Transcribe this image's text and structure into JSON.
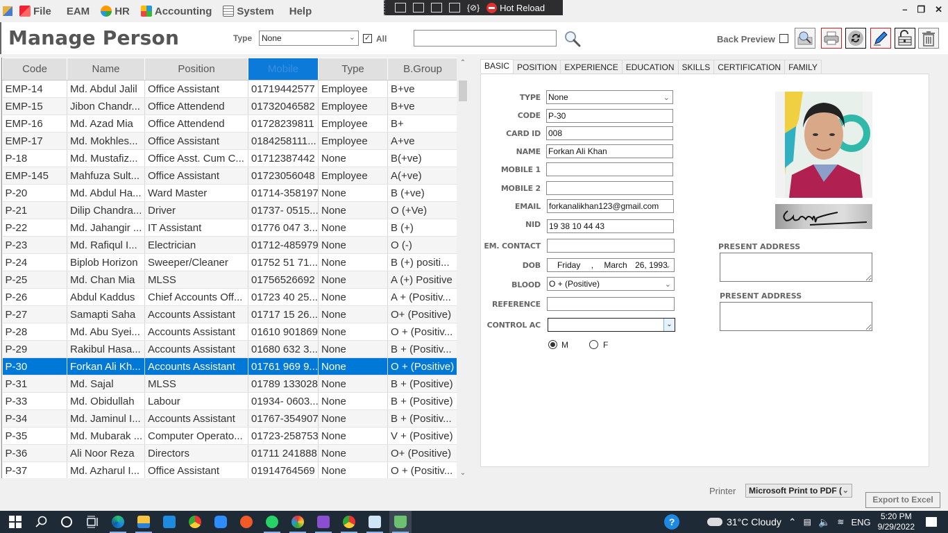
{
  "menubar": {
    "items": [
      {
        "label": "File",
        "icon": "file-icon"
      },
      {
        "label": "EAM",
        "icon": ""
      },
      {
        "label": "HR",
        "icon": "hr-icon"
      },
      {
        "label": "Accounting",
        "icon": "accounting-icon"
      },
      {
        "label": "System",
        "icon": "system-icon"
      },
      {
        "label": "Help",
        "icon": ""
      }
    ]
  },
  "devtools": {
    "hot_reload_label": "Hot Reload"
  },
  "window_controls": {
    "minimize": "–",
    "restore": "❐",
    "close": "✕"
  },
  "header": {
    "title": "Manage Person",
    "type_label": "Type",
    "type_value": "None",
    "all_label": "All",
    "all_checked": true,
    "search_value": "",
    "back_preview_label": "Back Preview",
    "back_preview_checked": false
  },
  "grid": {
    "columns": [
      "Code",
      "Name",
      "Position",
      "Mobile",
      "Type",
      "B.Group"
    ],
    "sorted_column": "Mobile",
    "selected_code": "P-30",
    "rows": [
      [
        "EMP-14",
        "Md. Abdul Jalil",
        "Office Assistant",
        "01719442577",
        "Employee",
        "B+ve"
      ],
      [
        "EMP-15",
        "Jibon Chandr...",
        "Office Attendend",
        "01732046582",
        "Employee",
        "B+ve"
      ],
      [
        "EMP-16",
        "Md. Azad Mia",
        "Office Attendend",
        "01728239811",
        "Employee",
        "B+"
      ],
      [
        "EMP-17",
        "Md. Mokhles...",
        "Office Assistant",
        "0184258111...",
        "Employee",
        "A+ve"
      ],
      [
        "P-18",
        "Md. Mustafiz...",
        "Office Asst. Cum C...",
        "01712387442",
        "None",
        "B(+ve)"
      ],
      [
        "EMP-145",
        "Mahfuza Sult...",
        "Office Assistant",
        "01723056048",
        "Employee",
        "A(+ve)"
      ],
      [
        "P-20",
        "Md. Abdul Ha...",
        "Ward Master",
        "01714-358197",
        "None",
        "B (+ve)"
      ],
      [
        "P-21",
        "Dilip Chandra...",
        "Driver",
        "01737- 0515...",
        "None",
        "O (+Ve)"
      ],
      [
        "P-22",
        "Md. Jahangir ...",
        "IT Assistant",
        "01776 047 3...",
        "None",
        "B (+)"
      ],
      [
        "P-23",
        "Md. Rafiqul I...",
        "Electrician",
        "01712-485979",
        "None",
        "O (-)"
      ],
      [
        "P-24",
        "Biplob Horizon",
        "Sweeper/Cleaner",
        "01752 51 71...",
        "None",
        "B (+) positi..."
      ],
      [
        "P-25",
        "Md. Chan Mia",
        "MLSS",
        "01756526692",
        "None",
        "A (+) Positive"
      ],
      [
        "P-26",
        "Abdul Kaddus",
        "Chief Accounts Off...",
        "01723 40 25...",
        "None",
        "A + (Positiv..."
      ],
      [
        "P-27",
        "Samapti Saha",
        "Accounts Assistant",
        "01717 15 26...",
        "None",
        "O+ (Positive)"
      ],
      [
        "P-28",
        "Md. Abu Syei...",
        "Accounts Assistant",
        "01610 901869",
        "None",
        "O + (Positiv..."
      ],
      [
        "P-29",
        "Rakibul Hasa...",
        "Accounts Assistant",
        "01680 632 3...",
        "None",
        "B + (Positiv..."
      ],
      [
        "P-30",
        "Forkan Ali Kh...",
        "Accounts Assistant",
        "01761 969 9...",
        "None",
        "O + (Positive)"
      ],
      [
        "P-31",
        "Md. Sajal",
        "MLSS",
        "01789 133028",
        "None",
        "B + (Positive)"
      ],
      [
        "P-33",
        "Md. Obidullah",
        "Labour",
        "01934- 0603...",
        "None",
        "B + (Positive)"
      ],
      [
        "P-34",
        "Md. Jaminul I...",
        "Accounts Assistant",
        "01767-354907",
        "None",
        "B + (Positiv..."
      ],
      [
        "P-35",
        "Md. Mubarak ...",
        "Computer Operato...",
        "01723-258753",
        "None",
        "V + (Positive)"
      ],
      [
        "P-36",
        "Ali Noor Reza",
        "Directors",
        "01711 241888",
        "None",
        "O+ (Positive)"
      ],
      [
        "P-37",
        "Md. Azharul I...",
        "Office Assistant",
        "01914764569",
        "None",
        "O + (Positiv..."
      ]
    ]
  },
  "tabs": [
    "BASIC",
    "POSITION",
    "EXPERIENCE",
    "EDUCATION",
    "SKILLS",
    "CERTIFICATION",
    "FAMILY"
  ],
  "active_tab": "BASIC",
  "form": {
    "type": {
      "label": "TYPE",
      "value": "None"
    },
    "code": {
      "label": "CODE",
      "value": "P-30"
    },
    "card_id": {
      "label": "CARD ID",
      "value": "008"
    },
    "name": {
      "label": "NAME",
      "value": "Forkan Ali Khan"
    },
    "mobile1": {
      "label": "MOBILE 1",
      "value": ""
    },
    "mobile2": {
      "label": "MOBILE 2",
      "value": ""
    },
    "email": {
      "label": "EMAIL",
      "value": "forkanalikhan123@gmail.com"
    },
    "nid": {
      "label": "NID",
      "value": "19 38 10 44 43"
    },
    "em_contact": {
      "label": "EM. CONTACT",
      "value": ""
    },
    "dob": {
      "label": "DOB",
      "day": "Friday",
      "sep": ",",
      "month": "March",
      "date": "26, 1993"
    },
    "blood": {
      "label": "BLOOD",
      "value": "O + (Positive)"
    },
    "reference": {
      "label": "REFERENCE",
      "value": ""
    },
    "control_ac": {
      "label": "CONTROL AC",
      "value": ""
    },
    "gender": {
      "options": [
        "M",
        "F"
      ],
      "selected": "M"
    },
    "present_address_label": "PRESENT ADDRESS",
    "present_address_value": "",
    "second_address_label": "PRESENT ADDRESS",
    "second_address_value": ""
  },
  "footer": {
    "printer_label": "Printer",
    "printer_value": "Microsoft Print to PDF (",
    "export_label": "Export to Excel"
  },
  "taskbar": {
    "weather": "31°C  Cloudy",
    "language": "ENG",
    "time": "5:20 PM",
    "date": "9/29/2022"
  }
}
